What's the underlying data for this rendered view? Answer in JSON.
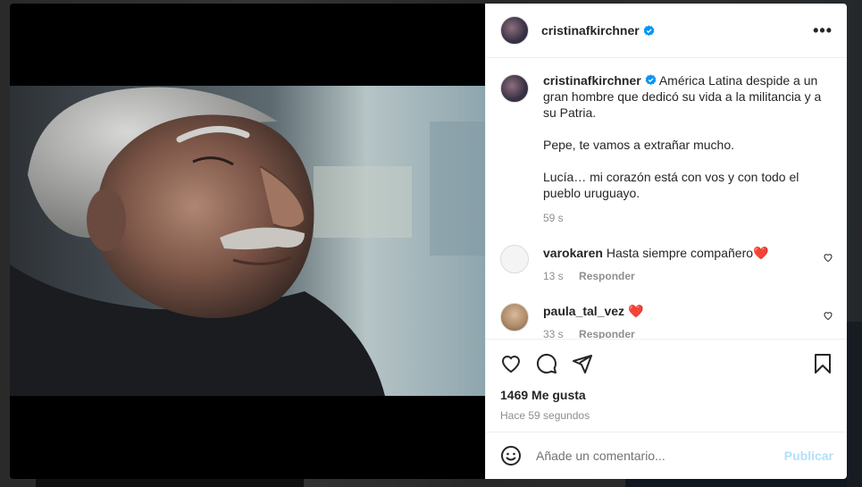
{
  "post": {
    "author": "cristinafkirchner",
    "caption_paragraphs": [
      "América Latina despide a un gran hombre que dedicó su vida a la militancia y a su Patria.",
      "Pepe, te vamos a extrañar mucho.",
      "Lucía… mi corazón está con vos y con todo el pueblo uruguayo."
    ],
    "caption_time": "59 s",
    "likes": "1469 Me gusta",
    "posted_ago": "Hace 59 segundos"
  },
  "comments": [
    {
      "user": "varokaren",
      "text": "Hasta siempre compañero",
      "emoji": "❤️",
      "time": "13 s",
      "reply": "Responder"
    },
    {
      "user": "paula_tal_vez",
      "text": "",
      "emoji": "❤️",
      "time": "33 s",
      "reply": "Responder"
    }
  ],
  "composer": {
    "placeholder": "Añade un comentario...",
    "publish": "Publicar"
  },
  "icons": {
    "more": "more-options-icon",
    "verified": "verified-badge-icon",
    "like": "heart-icon",
    "comment": "comment-icon",
    "share": "send-icon",
    "save": "bookmark-icon",
    "emoji": "emoji-icon"
  },
  "colors": {
    "verified": "#0095f6",
    "publish_disabled": "#b2dffc",
    "heart": "#ed4956"
  }
}
